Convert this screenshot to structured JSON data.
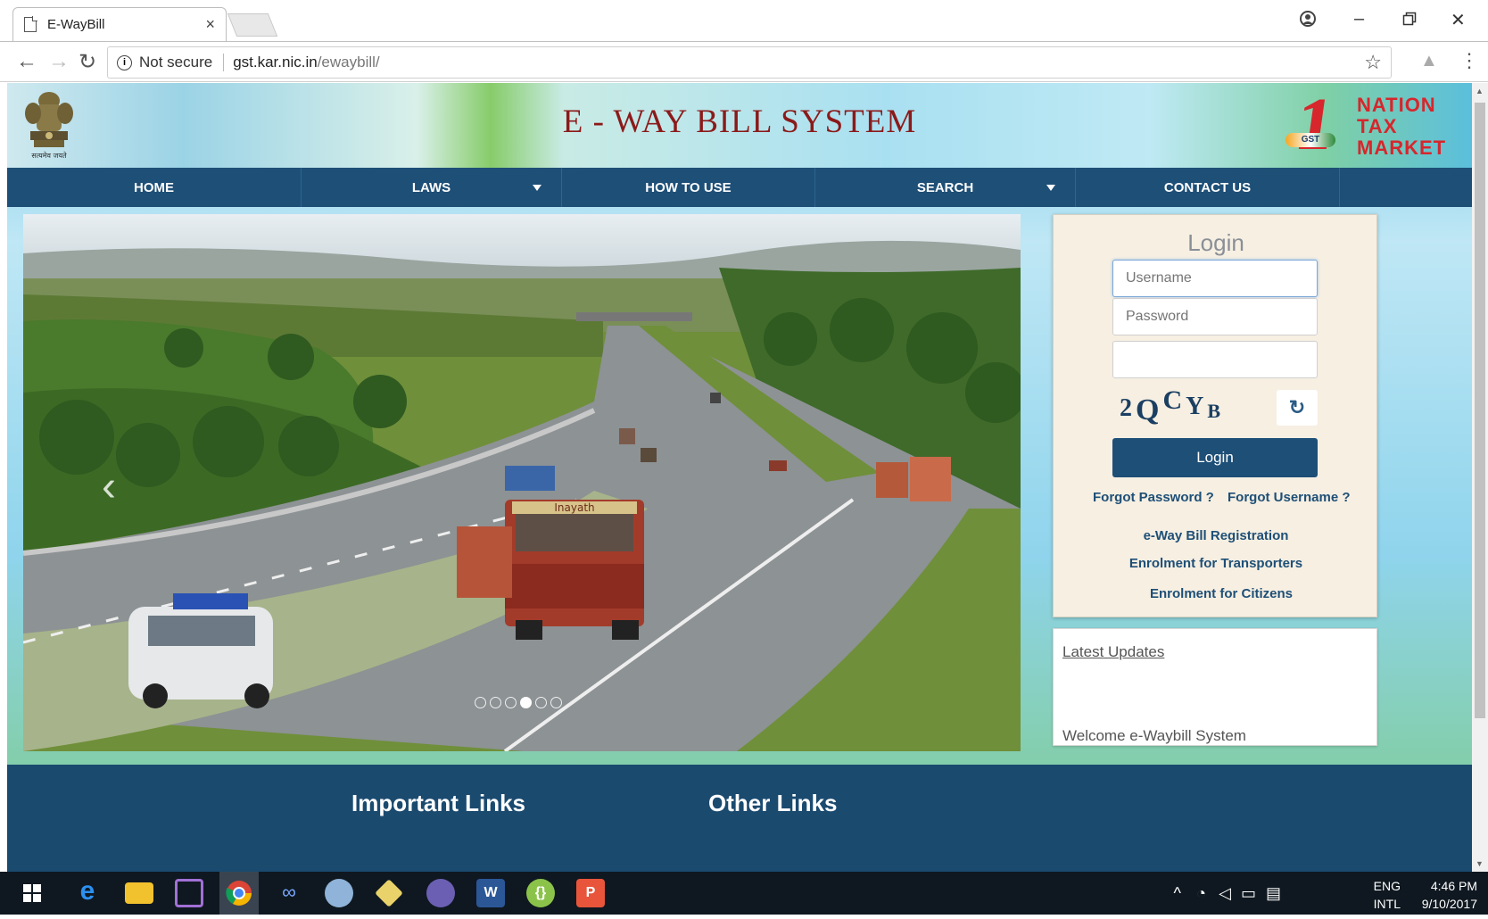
{
  "browser": {
    "tab_title": "E-WayBill",
    "tab_close": "×",
    "security_label": "Not secure",
    "url_host": "gst.kar.nic.in",
    "url_path": "/ewaybill/"
  },
  "header": {
    "site_title": "E - WAY BILL SYSTEM",
    "emblem_caption": "सत्यमेव जयते",
    "brand_number": "1",
    "brand_words": [
      "NATION",
      "TAX",
      "MARKET"
    ],
    "brand_badge": "GST"
  },
  "menu": [
    {
      "label": "HOME",
      "dropdown": false
    },
    {
      "label": "LAWS",
      "dropdown": true
    },
    {
      "label": "HOW TO USE",
      "dropdown": false
    },
    {
      "label": "SEARCH",
      "dropdown": true
    },
    {
      "label": "CONTACT US",
      "dropdown": false
    }
  ],
  "slider": {
    "prev_icon": "‹",
    "dot_count": 6,
    "active_dot": 4,
    "truck_sign": "Inayath"
  },
  "login": {
    "heading": "Login",
    "username_placeholder": "Username",
    "password_placeholder": "Password",
    "captcha_text": "2QCYB",
    "refresh_icon": "↻",
    "button_label": "Login",
    "forgot_password": "Forgot Password ?",
    "forgot_username": "Forgot Username ?",
    "links": [
      "e-Way Bill Registration",
      "Enrolment for Transporters",
      "Enrolment for Citizens"
    ]
  },
  "updates": {
    "heading": "Latest Updates",
    "ticker": "Welcome e-Waybill System"
  },
  "footer": {
    "important_links": "Important Links",
    "other_links": "Other Links"
  },
  "taskbar": {
    "lang_line1": "ENG",
    "lang_line2": "INTL",
    "time": "4:46 PM",
    "date": "9/10/2017"
  },
  "colors": {
    "nav_blue": "#1e4f77",
    "title_red": "#8b1a1a",
    "login_bg": "#f6efe2"
  }
}
